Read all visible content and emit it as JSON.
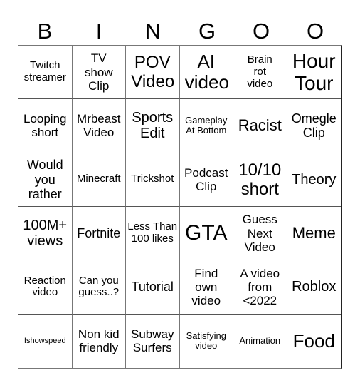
{
  "header": {
    "letters": [
      "B",
      "I",
      "N",
      "G",
      "O",
      "O"
    ]
  },
  "cells": [
    [
      "Twitch streamer",
      "TV show Clip",
      "POV Video",
      "AI video",
      "Brain rot video",
      "Hour Tour"
    ],
    [
      "Looping short",
      "Mrbeast Video",
      "Sports Edit",
      "Gameplay At Bottom",
      "Racist",
      "Omegle Clip"
    ],
    [
      "Would you rather",
      "Minecraft",
      "Trickshot",
      "Podcast Clip",
      "10/10 short",
      "Theory"
    ],
    [
      "100M+ views",
      "Fortnite",
      "Less Than 100 likes",
      "GTA",
      "Guess Next Video",
      "Meme"
    ],
    [
      "Reaction video",
      "Can you guess..?",
      "Tutorial",
      "Find own video",
      "A video from <2022",
      "Roblox"
    ],
    [
      "Ishowspeed",
      "Non kid friendly",
      "Subway Surfers",
      "Satisfying video",
      "Animation",
      "Food"
    ]
  ]
}
